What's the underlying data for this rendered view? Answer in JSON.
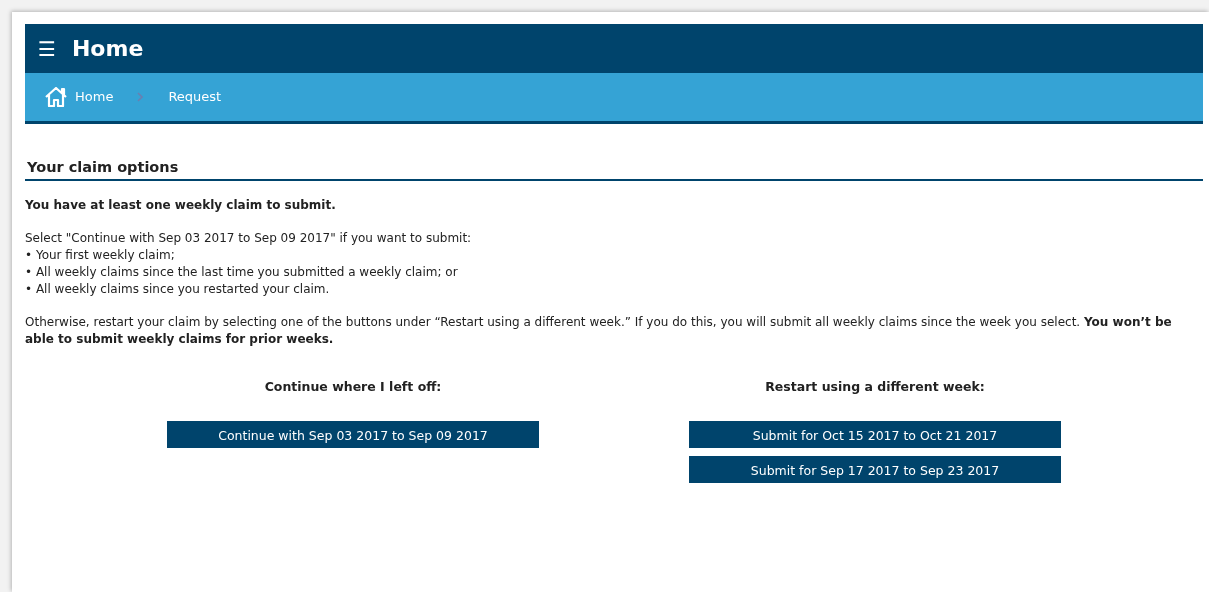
{
  "header": {
    "menu_glyph": "☰",
    "title": "Home"
  },
  "breadcrumb": [
    {
      "label": "Home",
      "kind": "home"
    },
    {
      "label": "Request",
      "kind": "page"
    }
  ],
  "section_title": "Your claim options",
  "intro": "You have at least one weekly claim to submit.",
  "select_text": "Select \"Continue with Sep 03 2017 to Sep 09 2017\" if you want to submit:",
  "bullets": [
    "• Your first weekly claim;",
    "• All weekly claims since the last time you submitted a weekly claim; or",
    "• All weekly claims since you restarted your claim."
  ],
  "otherwise_text": "Otherwise, restart your claim by selecting one of the buttons under “Restart using a different week.” If you do this, you will submit all weekly claims since the week you select. **You won’t be able to submit weekly claims for prior weeks.**",
  "columns": [
    {
      "heading": "Continue where I left off:",
      "buttons": [
        "Continue with Sep 03 2017 to Sep 09 2017"
      ]
    },
    {
      "heading": "Restart using a different week:",
      "buttons": [
        "Submit for Oct 15 2017 to Oct 21 2017",
        "Submit for Sep 17 2017 to Sep 23 2017"
      ]
    }
  ]
}
